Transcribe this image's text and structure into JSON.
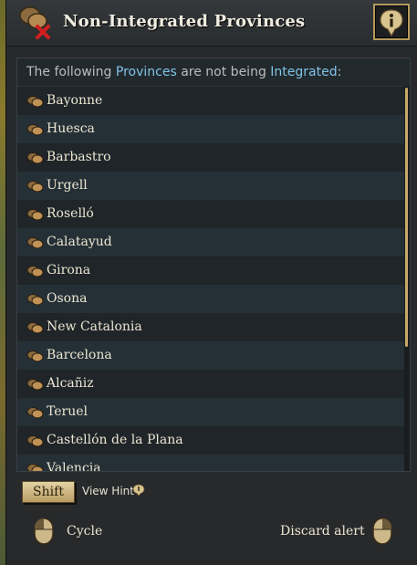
{
  "header": {
    "title": "Non-Integrated Provinces",
    "info_icon": "info-icon",
    "alert_icon": "province-alert-icon"
  },
  "intro": {
    "prefix": "The following ",
    "provinces_word": "Provinces",
    "middle": " are not being ",
    "integrated_word": "Integrated",
    "suffix": ":"
  },
  "provinces": [
    "Bayonne",
    "Huesca",
    "Barbastro",
    "Urgell",
    "Roselló",
    "Calatayud",
    "Girona",
    "Osona",
    "New Catalonia",
    "Barcelona",
    "Alcañiz",
    "Teruel",
    "Castellón de la Plana",
    "Valencia"
  ],
  "footer": {
    "shift_key": "Shift",
    "view_hint": "View Hint",
    "cycle": "Cycle",
    "discard_alert": "Discard alert"
  },
  "colors": {
    "highlight": "#7fc3e6",
    "accent_gold": "#b49a5a"
  }
}
